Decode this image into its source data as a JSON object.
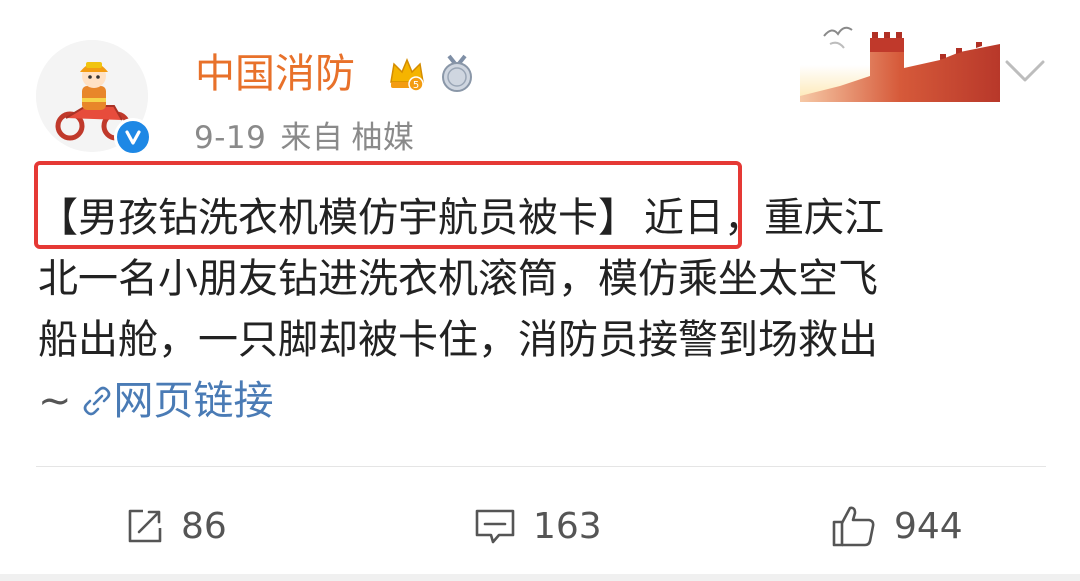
{
  "author": {
    "name": "中国消防",
    "verified": true,
    "date": "9-19",
    "source_prefix": "来自",
    "source": "柚媒"
  },
  "post": {
    "lines": [
      {
        "highlight": "【男孩钻洗衣机模仿宇航员被卡】",
        "rest": "近日，重庆江"
      },
      {
        "text": "北一名小朋友钻进洗衣机滚筒，模仿乘坐太空飞"
      },
      {
        "text": "船出舱，一只脚却被卡住，消防员接警到场救出"
      }
    ],
    "tail": "~",
    "link_label": "网页链接"
  },
  "actions": {
    "repost_count": "86",
    "comment_count": "163",
    "like_count": "944"
  },
  "colors": {
    "name": "#e8712a",
    "link": "#4a7bb5",
    "highlight_box": "#e53935",
    "verified": "#1e88e5",
    "meta": "#8a8a8a"
  },
  "icons": {
    "avatar": "firefighter-on-motorcycle-avatar",
    "verified": "verified-check-icon",
    "crown_badge": "crown-badge-icon",
    "medal_badge": "medal-badge-icon",
    "decoration": "great-wall-decoration",
    "more": "chevron-down-icon",
    "link": "link-icon",
    "repost": "repost-icon",
    "comment": "comment-icon",
    "like": "thumbs-up-icon"
  }
}
